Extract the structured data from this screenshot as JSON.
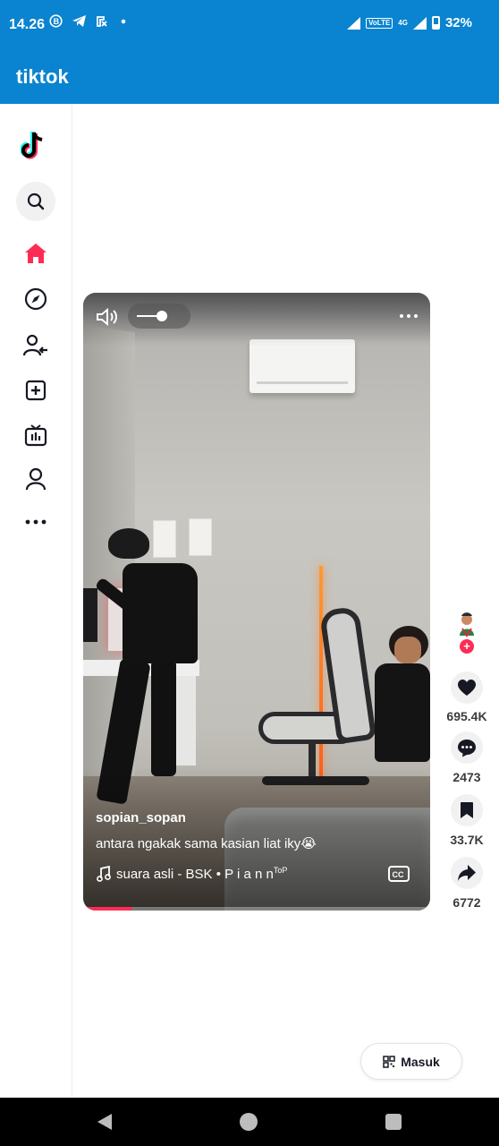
{
  "status_bar": {
    "time": "14.26",
    "network_label": "VoLTE",
    "network_type": "4G",
    "battery": "32%"
  },
  "app_bar": {
    "title": "tiktok"
  },
  "sidebar": {
    "items": [
      {
        "name": "tiktok-logo-icon"
      },
      {
        "name": "search-icon"
      },
      {
        "name": "home-icon"
      },
      {
        "name": "explore-icon"
      },
      {
        "name": "following-icon"
      },
      {
        "name": "upload-icon"
      },
      {
        "name": "live-icon"
      },
      {
        "name": "profile-icon"
      },
      {
        "name": "more-icon"
      }
    ]
  },
  "video": {
    "author": "sopian_sopan",
    "caption": "antara ngakak sama kasian liat iky😭",
    "music": "suara asli - BSK • P i a n n",
    "music_badge": "ToP",
    "volume_level": 0.55,
    "progress": 0.14
  },
  "actions": {
    "likes": "695.4K",
    "comments": "2473",
    "saves": "33.7K",
    "shares": "6772",
    "follow_symbol": "+"
  },
  "login": {
    "label": "Masuk"
  },
  "colors": {
    "accent": "#fe2c55",
    "app_bar": "#0a84d0",
    "nav_bar": "#000000"
  }
}
